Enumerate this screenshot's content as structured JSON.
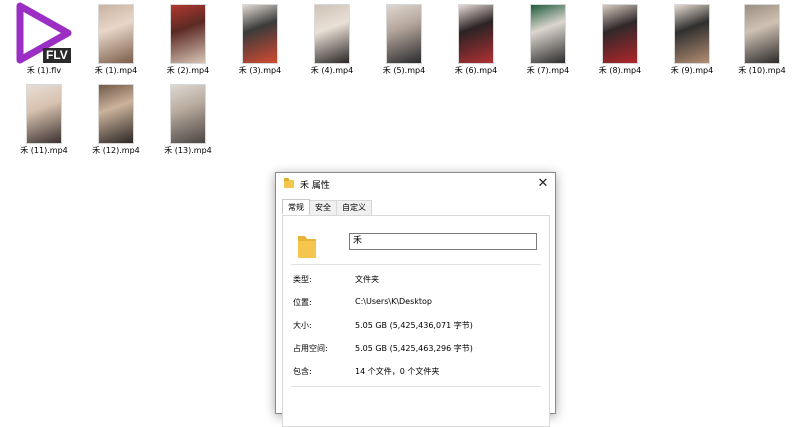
{
  "files": [
    {
      "name": "禾 (1).flv",
      "type": "flv",
      "badge": "FLV"
    },
    {
      "name": "禾 (1).mp4",
      "type": "video",
      "colors": [
        "#c9b3a2",
        "#7b5d4a",
        "#e8d6c8"
      ]
    },
    {
      "name": "禾 (2).mp4",
      "type": "video",
      "colors": [
        "#b0382f",
        "#d8c6b6",
        "#5c2a24"
      ]
    },
    {
      "name": "禾 (3).mp4",
      "type": "video",
      "colors": [
        "#e2dad2",
        "#d34a31",
        "#3b3b3b"
      ]
    },
    {
      "name": "禾 (4).mp4",
      "type": "video",
      "colors": [
        "#cfc2b6",
        "#2b2625",
        "#e9e0d6"
      ]
    },
    {
      "name": "禾 (5).mp4",
      "type": "video",
      "colors": [
        "#ded7d2",
        "#2a2a2e",
        "#b4a59a"
      ]
    },
    {
      "name": "禾 (6).mp4",
      "type": "video",
      "colors": [
        "#e7dad6",
        "#b23032",
        "#2b2325"
      ]
    },
    {
      "name": "禾 (7).mp4",
      "type": "video",
      "colors": [
        "#1f5b3d",
        "#2b2b2b",
        "#dcd6cf"
      ]
    },
    {
      "name": "禾 (8).mp4",
      "type": "video",
      "colors": [
        "#d9cbbf",
        "#b2262a",
        "#30282a"
      ]
    },
    {
      "name": "禾 (9).mp4",
      "type": "video",
      "colors": [
        "#e6dbd1",
        "#b48e73",
        "#2f2f2f"
      ]
    },
    {
      "name": "禾 (10).mp4",
      "type": "video",
      "colors": [
        "#9b8e81",
        "#2c2a29",
        "#cfc2b4"
      ]
    },
    {
      "name": "禾 (11).mp4",
      "type": "video",
      "colors": [
        "#e8ded5",
        "#3b3130",
        "#d7c1ae"
      ]
    },
    {
      "name": "禾 (12).mp4",
      "type": "video",
      "colors": [
        "#705948",
        "#2b2623",
        "#cbb39c"
      ]
    },
    {
      "name": "禾 (13).mp4",
      "type": "video",
      "colors": [
        "#ddd8d2",
        "#4b4543",
        "#b9ab9e"
      ]
    }
  ],
  "dialog": {
    "title": "禾 属性",
    "close_icon": "close-icon",
    "tabs": [
      "常规",
      "安全",
      "自定义"
    ],
    "folder_name": "禾",
    "rows": [
      {
        "label": "类型:",
        "value": "文件夹"
      },
      {
        "label": "位置:",
        "value": "C:\\Users\\K\\Desktop"
      },
      {
        "label": "大小:",
        "value": "5.05 GB (5,425,436,071 字节)"
      },
      {
        "label": "占用空间:",
        "value": "5.05 GB (5,425,463,296 字节)"
      },
      {
        "label": "包含:",
        "value": "14 个文件，0 个文件夹"
      }
    ]
  },
  "colors": {
    "accent": "#9b2fc4",
    "folder": "#f5c64e"
  }
}
